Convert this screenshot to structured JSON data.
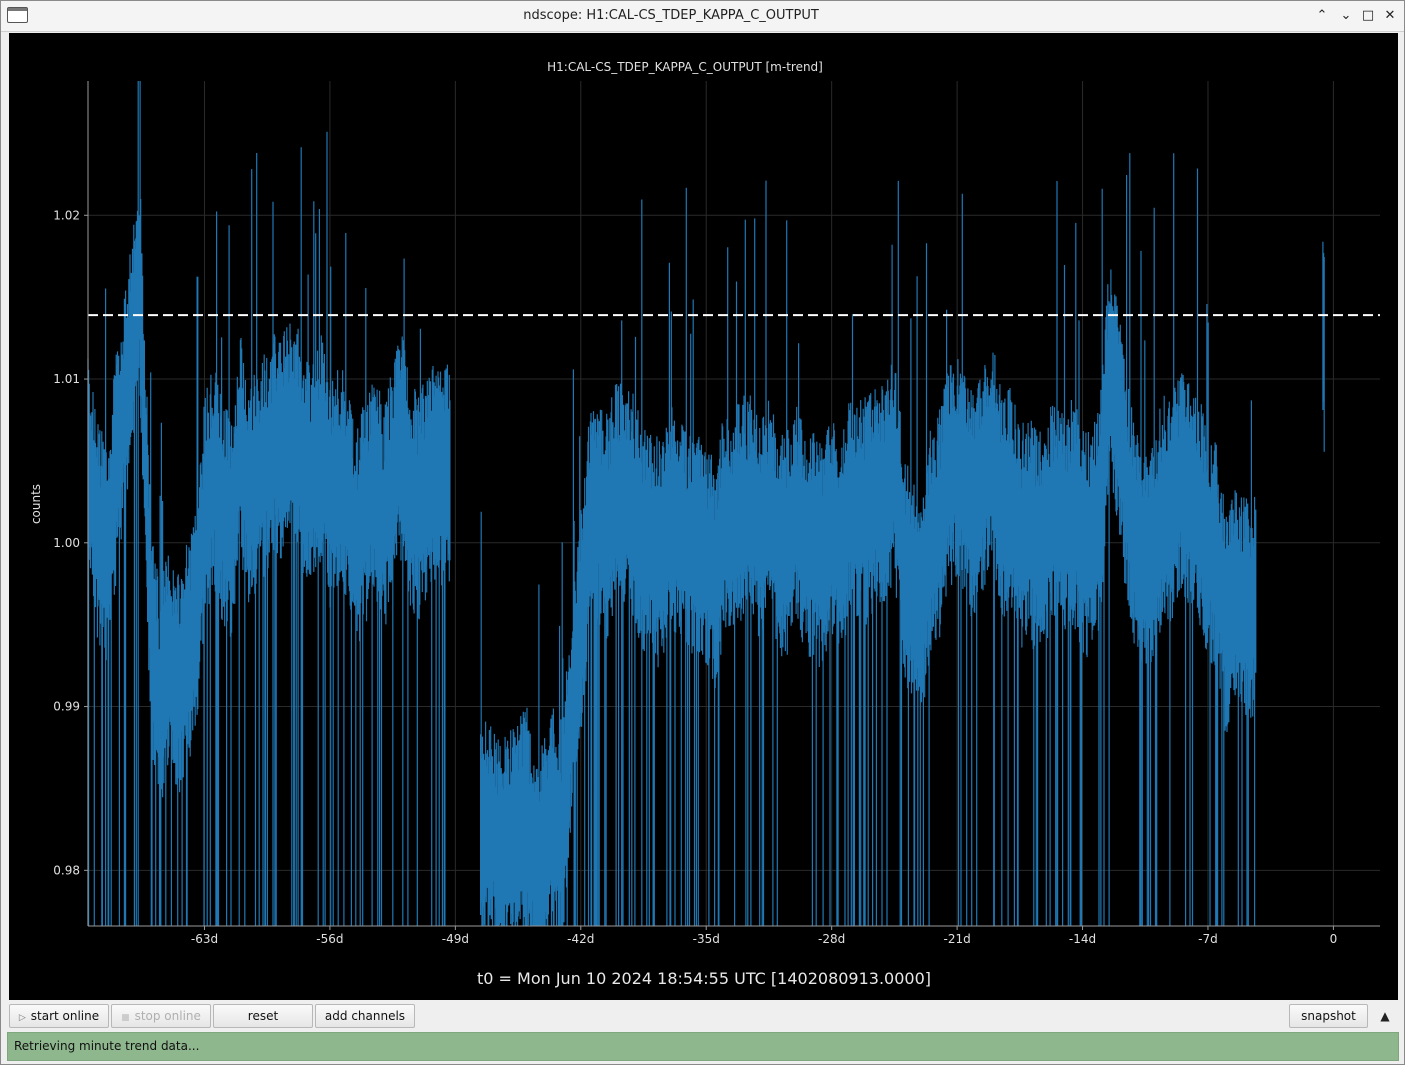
{
  "window": {
    "title": "ndscope: H1:CAL-CS_TDEP_KAPPA_C_OUTPUT",
    "controls": {
      "minimize": "⌃",
      "shade": "⌄",
      "maximize": "□",
      "close": "✕"
    }
  },
  "plot": {
    "title": "H1:CAL-CS_TDEP_KAPPA_C_OUTPUT [m-trend]",
    "ylabel": "counts",
    "t0_label": "t0 = Mon Jun 10 2024 18:54:55 UTC [1402080913.0000]"
  },
  "toolbar": {
    "start_online": "start online",
    "stop_online": "stop online",
    "reset": "reset",
    "add_channels": "add channels",
    "snapshot": "snapshot",
    "collapse_arrow": "▲"
  },
  "status": {
    "text": "Retrieving minute trend data..."
  },
  "colors": {
    "trace": "#1f77b4",
    "reference": "#ffffff",
    "status": "#8fb78e"
  },
  "chart_data": {
    "type": "line",
    "title": "H1:CAL-CS_TDEP_KAPPA_C_OUTPUT [m-trend]",
    "xlabel": "",
    "ylabel": "counts",
    "x_unit": "days",
    "xlim": [
      -69.5,
      2.6
    ],
    "ylim": [
      0.9766,
      1.0282
    ],
    "x_ticks": [
      -63,
      -56,
      -49,
      -42,
      -35,
      -28,
      -21,
      -14,
      -7,
      0
    ],
    "x_tick_labels": [
      "-63d",
      "-56d",
      "-49d",
      "-42d",
      "-35d",
      "-28d",
      "-21d",
      "-14d",
      "-7d",
      "0"
    ],
    "y_ticks": [
      0.98,
      0.99,
      1.0,
      1.01,
      1.02
    ],
    "y_tick_labels": [
      "0.98",
      "0.99",
      "1.00",
      "1.01",
      "1.02"
    ],
    "grid": true,
    "reference_line": {
      "y": 1.0139,
      "style": "dashed"
    },
    "series": [
      {
        "values_x": [
          -69.5,
          -69.2,
          -68.5,
          -68.0,
          -67.5,
          -67.0,
          -66.6,
          -66.0,
          -65.5,
          -65.0,
          -64.5,
          -64.0,
          -63.5,
          -63.0,
          -62.5,
          -62.0,
          -61.5,
          -61.0,
          -60.5,
          -60.0,
          -59.5,
          -59.0,
          -58.5,
          -58.0,
          -57.5,
          -57.0,
          -56.5,
          -56.0,
          -55.5,
          -55.0,
          -54.5,
          -54.0,
          -53.5,
          -53.0,
          -52.5,
          -52.0,
          -51.5,
          -51.0,
          -50.5,
          -50.0,
          -49.5,
          -49.0,
          -48.5,
          -48.0,
          -47.5,
          -47.0,
          -46.5,
          -46.0,
          -45.5,
          -45.0,
          -44.5,
          -44.0,
          -43.5,
          -43.0,
          -42.5,
          -42.0,
          -41.5,
          -41.0,
          -40.5,
          -40.0,
          -39.5,
          -39.0,
          -38.5,
          -38.0,
          -37.5,
          -37.0,
          -36.5,
          -36.0,
          -35.5,
          -35.0,
          -34.5,
          -34.0,
          -33.5,
          -33.0,
          -32.5,
          -32.0,
          -31.5,
          -31.0,
          -30.5,
          -30.0,
          -29.5,
          -29.0,
          -28.5,
          -28.0,
          -27.5,
          -27.0,
          -26.5,
          -26.0,
          -25.5,
          -25.0,
          -24.5,
          -24.0,
          -23.5,
          -23.0,
          -22.5,
          -22.0,
          -21.5,
          -21.0,
          -20.5,
          -20.0,
          -19.5,
          -19.0,
          -18.5,
          -18.0,
          -17.5,
          -17.0,
          -16.5,
          -16.0,
          -15.5,
          -15.0,
          -14.5,
          -14.0,
          -13.5,
          -13.0,
          -12.5,
          -12.0,
          -11.5,
          -11.0,
          -10.5,
          -10.0,
          -9.5,
          -9.0,
          -8.5,
          -8.0,
          -7.5,
          -7.0,
          -6.5,
          -6.0,
          -5.5,
          -5.0,
          -4.5,
          -4.0,
          -0.5,
          0.0
        ],
        "values_y": [
          1.006,
          1.002,
          0.999,
          1.004,
          1.008,
          1.013,
          1.016,
          0.995,
          0.99,
          0.993,
          0.991,
          0.993,
          0.995,
          1.002,
          1.004,
          1.002,
          1.001,
          1.006,
          1.003,
          1.004,
          1.005,
          1.006,
          1.006,
          1.007,
          1.005,
          1.004,
          1.006,
          1.003,
          1.004,
          1.003,
          1.0,
          1.002,
          1.004,
          1.001,
          1.004,
          1.006,
          1.003,
          1.002,
          1.004,
          1.004,
          1.004,
          1.004,
          0.985,
          0.983,
          0.982,
          0.983,
          0.981,
          0.982,
          0.983,
          0.983,
          0.98,
          0.982,
          0.983,
          0.982,
          0.99,
          0.995,
          1.001,
          1.002,
          1.001,
          1.003,
          1.003,
          1.002,
          1.0,
          1.0,
          0.999,
          1.002,
          1.001,
          1.0,
          1.0,
          0.999,
          0.998,
          1.001,
          1.001,
          1.002,
          1.002,
          1.001,
          1.002,
          1.0,
          1.0,
          1.002,
          1.0,
          1.0,
          0.999,
          1.001,
          1.0,
          1.002,
          1.002,
          1.002,
          1.003,
          1.003,
          1.005,
          0.999,
          0.997,
          0.996,
          1.0,
          1.001,
          1.004,
          1.005,
          1.003,
          1.002,
          1.004,
          1.006,
          1.002,
          1.003,
          1.0,
          1.001,
          1.0,
          1.001,
          1.002,
          1.001,
          1.002,
          1.0,
          1.0,
          1.002,
          1.011,
          1.008,
          1.003,
          1.0,
          0.999,
          1.0,
          1.002,
          1.002,
          1.004,
          1.003,
          1.002,
          1.0,
          0.999,
          0.995,
          0.997,
          0.996,
          0.995,
          1.004,
          1.012
        ]
      }
    ]
  }
}
